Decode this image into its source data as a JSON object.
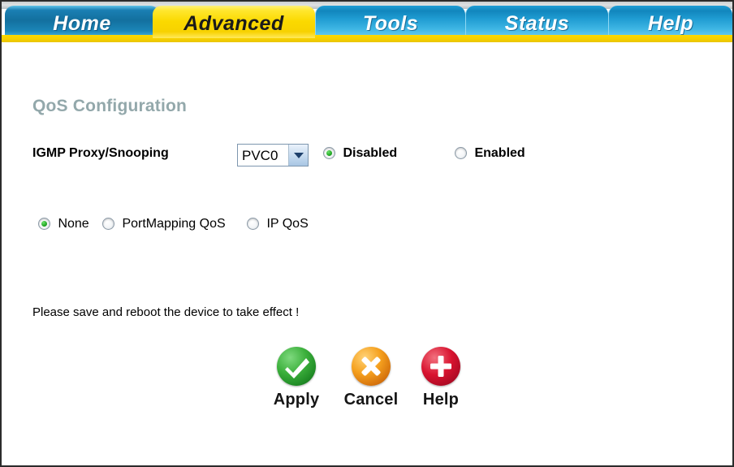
{
  "nav": {
    "tabs": [
      {
        "label": "Home",
        "active": false
      },
      {
        "label": "Advanced",
        "active": true
      },
      {
        "label": "Tools",
        "active": false
      },
      {
        "label": "Status",
        "active": false
      },
      {
        "label": "Help",
        "active": false
      }
    ]
  },
  "main": {
    "title": "QoS Configuration",
    "igmp": {
      "label": "IGMP Proxy/Snooping",
      "pvc_select": {
        "value": "PVC0",
        "arrow_icon": "chevron-down-icon"
      },
      "options": [
        {
          "label": "Disabled",
          "selected": true
        },
        {
          "label": "Enabled",
          "selected": false
        }
      ]
    },
    "qos_mode": {
      "options": [
        {
          "label": "None",
          "selected": true
        },
        {
          "label": "PortMapping QoS",
          "selected": false
        },
        {
          "label": "IP QoS",
          "selected": false
        }
      ]
    },
    "notice": "Please save and reboot the device to take effect !",
    "actions": [
      {
        "label": "Apply",
        "icon": "check-circle-icon",
        "color": "#2f9e35"
      },
      {
        "label": "Cancel",
        "icon": "cross-circle-icon",
        "color": "#e08a12"
      },
      {
        "label": "Help",
        "icon": "plus-circle-icon",
        "color": "#cc1030"
      }
    ]
  },
  "colors": {
    "tab_active_bg": "#fbd900",
    "tab_inactive_bg": "#1f9cd2",
    "title_text": "#93a8ab",
    "yellow_bar": "#fcd900"
  }
}
